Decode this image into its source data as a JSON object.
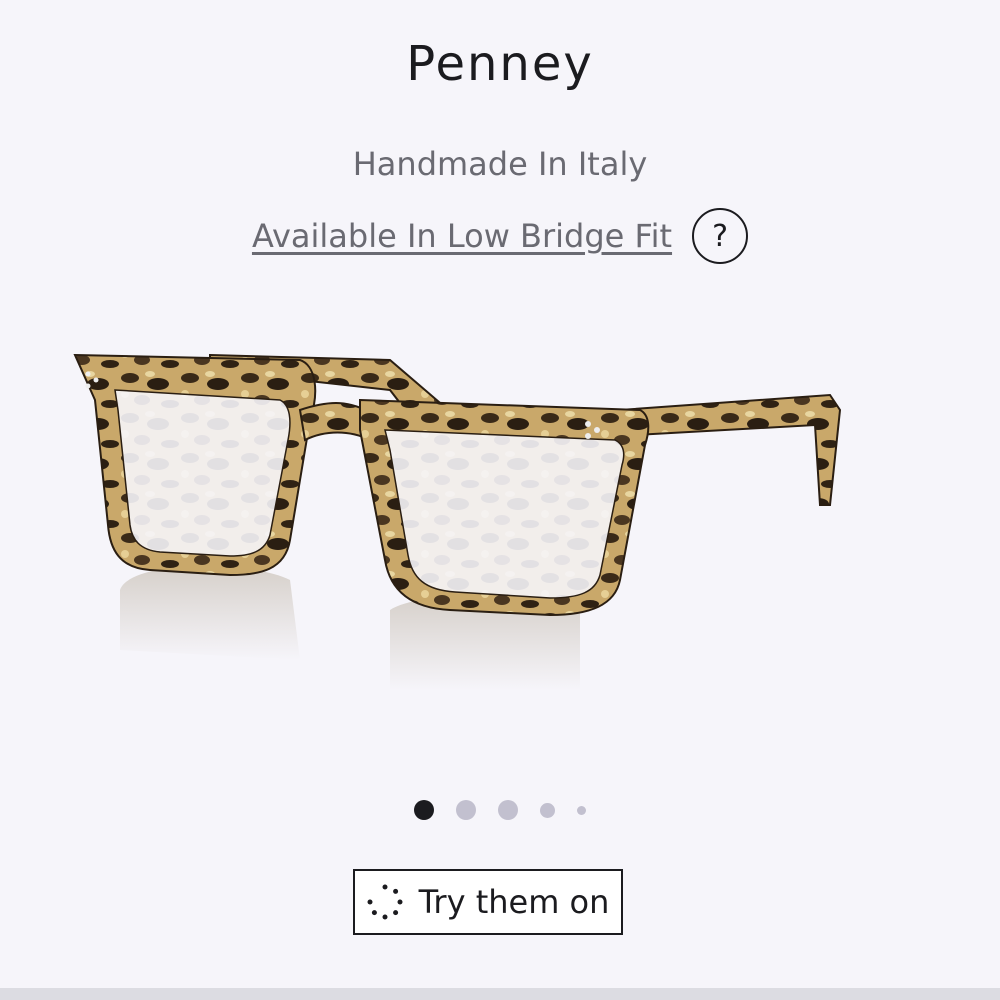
{
  "product": {
    "name": "Penney",
    "origin": "Handmade In Italy",
    "bridge_fit_link": "Available In Low Bridge Fit",
    "help_icon_glyph": "?"
  },
  "gallery": {
    "image_icon": "eyeglasses-tortoise-frame",
    "slide_count": 5,
    "active_slide": 1
  },
  "actions": {
    "try_on_label": "Try them on",
    "try_on_icon": "dotted-circle-icon"
  },
  "colors": {
    "background": "#f6f5fa",
    "text": "#1b1b1f",
    "muted_text": "#6a6a72",
    "dot_inactive": "#c2c0cf",
    "dot_active": "#1b1b1f"
  }
}
